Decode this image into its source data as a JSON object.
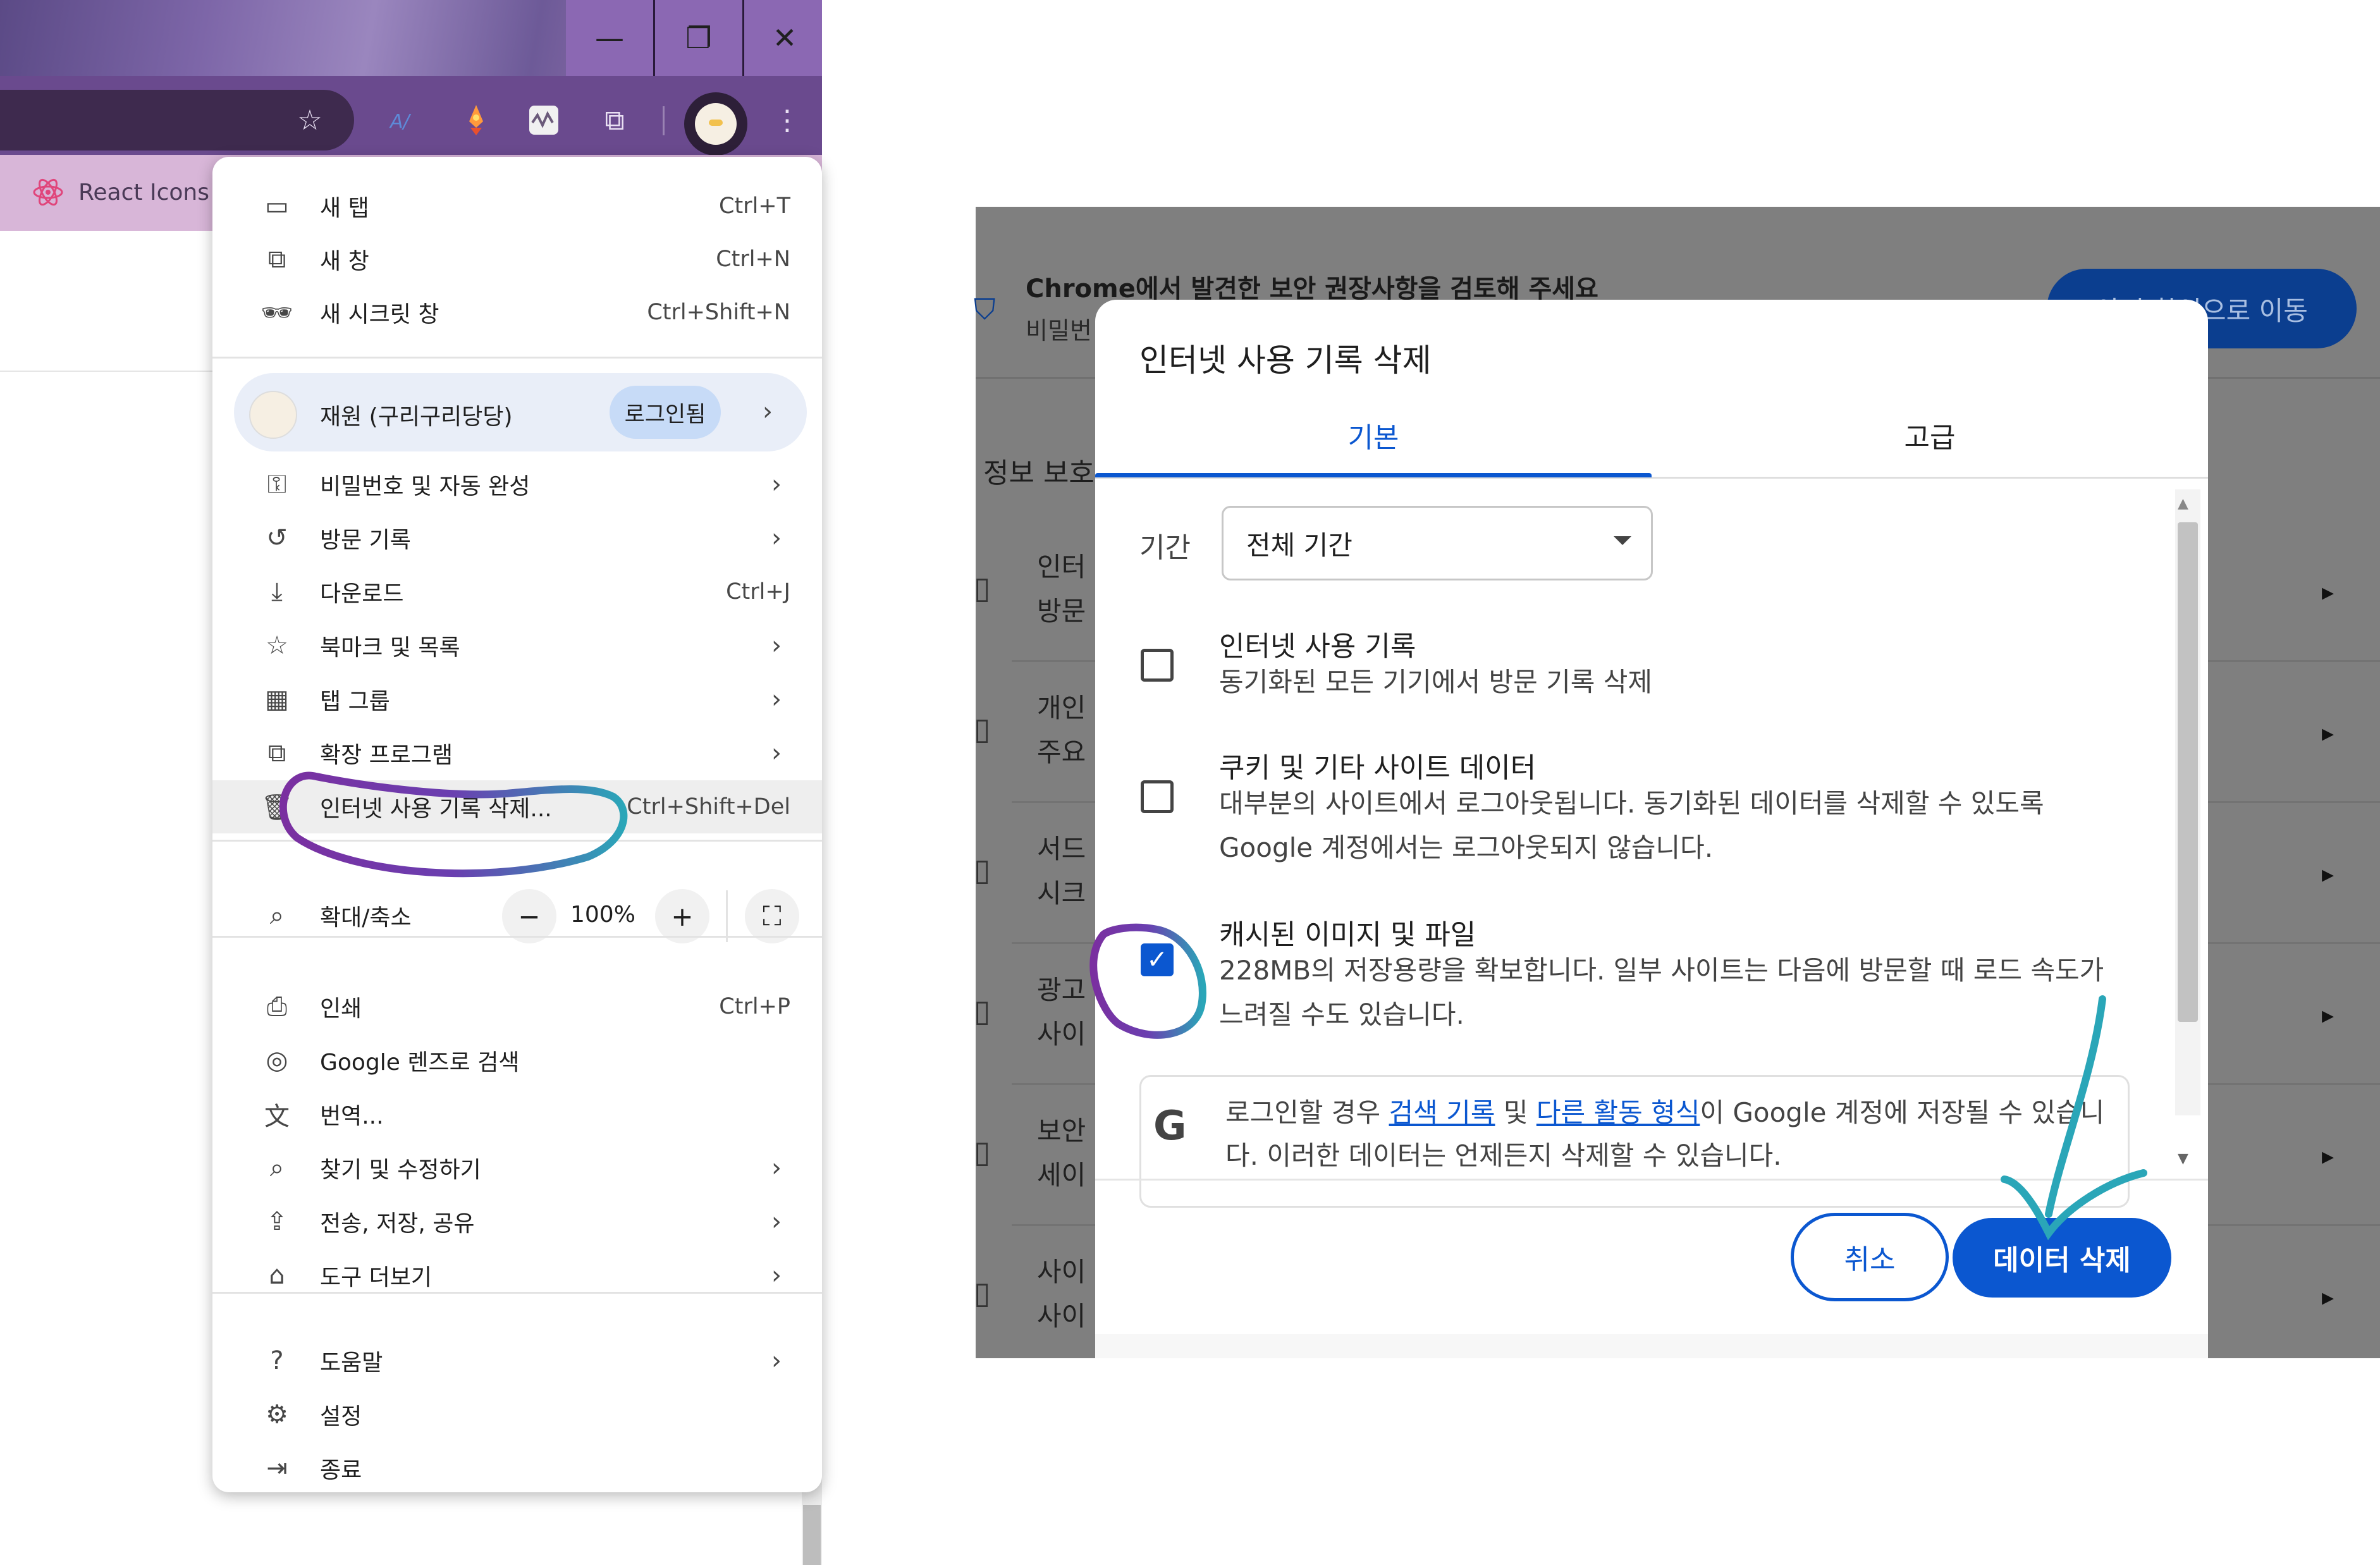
{
  "window": {
    "minimize_glyph": "—",
    "restore_glyph": "❐",
    "close_glyph": "✕"
  },
  "toolbar": {
    "bookmark_star_glyph": "☆",
    "extensions_glyph": "⧉",
    "menu_glyph": "⋮"
  },
  "bookmarks_bar": {
    "react_icons_label": "React Icons"
  },
  "chrome_menu": {
    "items_top": [
      {
        "icon": "new-tab-icon",
        "glyph": "▭",
        "label": "새 탭",
        "shortcut": "Ctrl+T"
      },
      {
        "icon": "new-window-icon",
        "glyph": "⧉",
        "label": "새 창",
        "shortcut": "Ctrl+N"
      },
      {
        "icon": "incognito-icon",
        "glyph": "🕶",
        "label": "새 시크릿 창",
        "shortcut": "Ctrl+Shift+N"
      }
    ],
    "profile": {
      "name": "재원 (구리구리당당)",
      "status_chip": "로그인됨",
      "arrow": "›"
    },
    "items_mid": [
      {
        "icon": "key-icon",
        "glyph": "⚿",
        "label": "비밀번호 및 자동 완성",
        "shortcut": "",
        "arrow": "›"
      },
      {
        "icon": "history-icon",
        "glyph": "↺",
        "label": "방문 기록",
        "shortcut": "",
        "arrow": "›"
      },
      {
        "icon": "download-icon",
        "glyph": "⤓",
        "label": "다운로드",
        "shortcut": "Ctrl+J",
        "arrow": ""
      },
      {
        "icon": "bookmark-star-icon",
        "glyph": "☆",
        "label": "북마크 및 목록",
        "shortcut": "",
        "arrow": "›"
      },
      {
        "icon": "tab-groups-icon",
        "glyph": "▦",
        "label": "탭 그룹",
        "shortcut": "",
        "arrow": "›"
      },
      {
        "icon": "extension-icon",
        "glyph": "⧉",
        "label": "확장 프로그램",
        "shortcut": "",
        "arrow": "›"
      },
      {
        "icon": "trash-icon",
        "glyph": "🗑",
        "label": "인터넷 사용 기록 삭제...",
        "shortcut": "Ctrl+Shift+Del",
        "arrow": ""
      }
    ],
    "zoom": {
      "label": "확대/축소",
      "minus": "−",
      "value": "100%",
      "plus": "+",
      "fullscreen_glyph": "⛶"
    },
    "items_bottom": [
      {
        "icon": "print-icon",
        "glyph": "⎙",
        "label": "인쇄",
        "shortcut": "Ctrl+P",
        "arrow": ""
      },
      {
        "icon": "google-lens-icon",
        "glyph": "◎",
        "label": "Google 렌즈로 검색",
        "shortcut": "",
        "arrow": ""
      },
      {
        "icon": "translate-icon",
        "glyph": "文",
        "label": "번역...",
        "shortcut": "",
        "arrow": ""
      },
      {
        "icon": "find-edit-icon",
        "glyph": "⌕",
        "label": "찾기 및 수정하기",
        "shortcut": "",
        "arrow": "›"
      },
      {
        "icon": "save-share-icon",
        "glyph": "⇪",
        "label": "전송, 저장, 공유",
        "shortcut": "",
        "arrow": "›"
      },
      {
        "icon": "more-tools-icon",
        "glyph": "⌂",
        "label": "도구 더보기",
        "shortcut": "",
        "arrow": "›"
      }
    ],
    "items_last": [
      {
        "icon": "help-icon",
        "glyph": "?",
        "label": "도움말",
        "shortcut": "",
        "arrow": "›"
      },
      {
        "icon": "settings-gear-icon",
        "glyph": "⚙",
        "label": "설정",
        "shortcut": "",
        "arrow": ""
      },
      {
        "icon": "exit-icon",
        "glyph": "⇥",
        "label": "종료",
        "shortcut": "",
        "arrow": ""
      }
    ]
  },
  "settings_page": {
    "banner_title": "Chrome에서 발견한 보안 권장사항을 검토해 주세요",
    "banner_subtitle": "비밀번",
    "banner_button": "안전 확인으로 이동",
    "section_heading": "정보 보호",
    "rows": [
      {
        "line1": "인터",
        "line2": "방문"
      },
      {
        "line1": "개인",
        "line2": "주요"
      },
      {
        "line1": "서드",
        "line2": "시크"
      },
      {
        "line1": "광고",
        "line2": "사이"
      },
      {
        "line1": "보안",
        "line2": "세이"
      },
      {
        "line1": "사이",
        "line2": "사이"
      }
    ],
    "row_arrow": "▸"
  },
  "clear_dialog": {
    "title": "인터넷 사용 기록 삭제",
    "tabs": [
      "기본",
      "고급"
    ],
    "active_tab": "기본",
    "period_label": "기간",
    "period_value": "전체 기간",
    "options": [
      {
        "title": "인터넷 사용 기록",
        "desc": "동기화된 모든 기기에서 방문 기록 삭제",
        "checked": false
      },
      {
        "title": "쿠키 및 기타 사이트 데이터",
        "desc": "대부분의 사이트에서 로그아웃됩니다. 동기화된 데이터를 삭제할 수 있도록 Google 계정에서는 로그아웃되지 않습니다.",
        "checked": false
      },
      {
        "title": "캐시된 이미지 및 파일",
        "desc": "228MB의 저장용량을 확보합니다. 일부 사이트는 다음에 방문할 때 로드 속도가 느려질 수도 있습니다.",
        "checked": true
      }
    ],
    "info": {
      "prefix": "로그인할 경우 ",
      "link1": "검색 기록",
      "middle": " 및 ",
      "link2": "다른 활동 형식",
      "suffix": "이 Google 계정에 저장될 수 있습니다. 이러한 데이터는 언제든지 삭제할 수 있습니다.",
      "logo_letter": "G"
    },
    "cancel_label": "취소",
    "delete_label": "데이터 삭제",
    "check_glyph": "✓"
  },
  "colors": {
    "accent_blue": "#0b57d0",
    "annotation_purple": "#7a2fa0",
    "annotation_teal": "#2aa6b8"
  }
}
